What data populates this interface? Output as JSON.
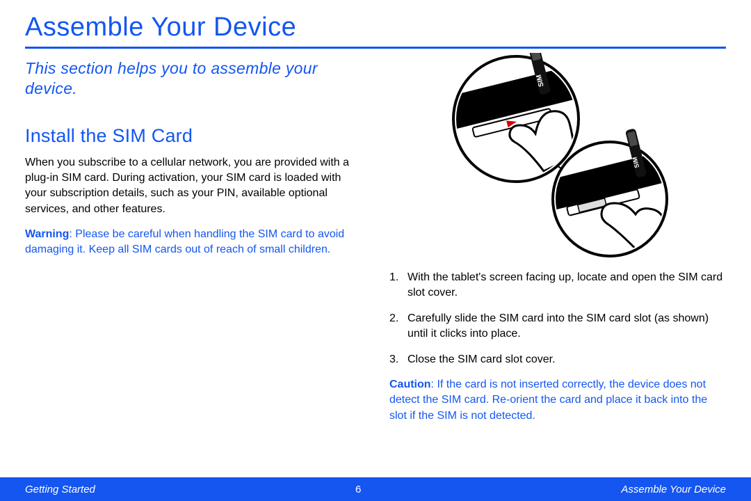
{
  "page_title": "Assemble Your Device",
  "intro": "This section helps you to assemble your device.",
  "subhead": "Install the SIM Card",
  "paragraph1": "When you subscribe to a cellular network, you are provided with a plug-in SIM card. During activation, your SIM card is loaded with your subscription details, such as your PIN, available optional services, and other features.",
  "warning_label": "Warning",
  "warning_text": ": Please be careful when handling the SIM card to avoid damaging it. Keep all SIM cards out of reach of small children.",
  "steps": [
    "With the tablet's screen facing up, locate and open the SIM card slot cover.",
    "Carefully slide the SIM card into the SIM card slot (as shown) until it clicks into place.",
    "Close the SIM card slot cover."
  ],
  "caution_label": "Caution",
  "caution_text": ": If the card is not inserted correctly, the device does not detect the SIM card. Re-orient the card and place it back into the slot if the SIM is not detected.",
  "footer": {
    "left": "Getting Started",
    "page_number": "6",
    "right": "Assemble Your Device"
  },
  "illustration_label": "sim-card-install-diagram"
}
